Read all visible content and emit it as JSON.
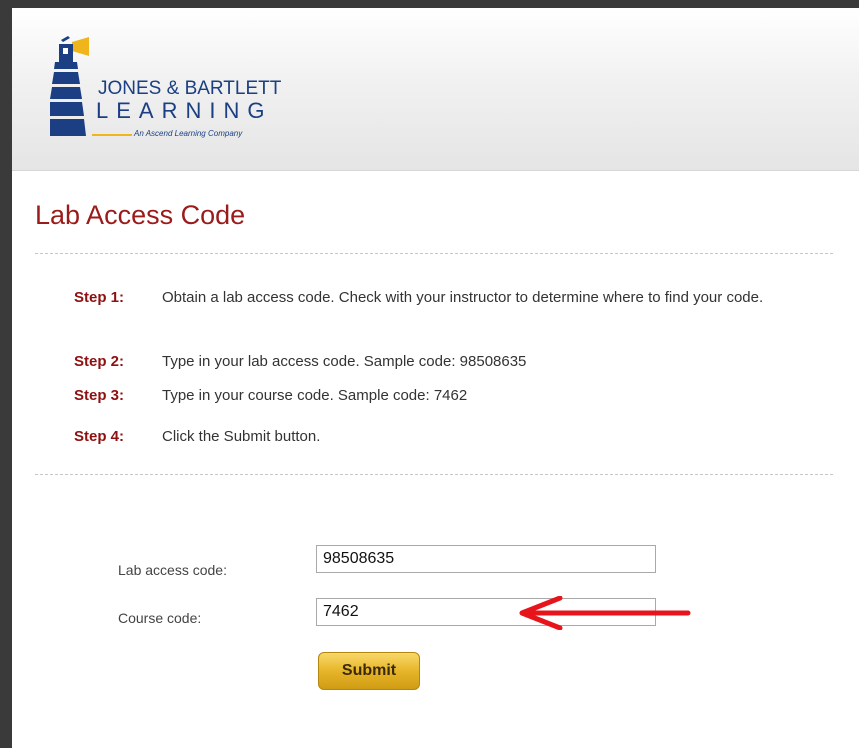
{
  "header": {
    "logo": {
      "brand_line1": "JONES & BARTLETT",
      "brand_line2": "LEARNING",
      "tagline": "An Ascend Learning Company",
      "colors": {
        "navy": "#1b3f82",
        "gold": "#f0b51a"
      }
    }
  },
  "page": {
    "title": "Lab Access Code"
  },
  "steps": [
    {
      "label": "Step 1:",
      "text": "Obtain a lab access code. Check with your instructor to determine where to find your code."
    },
    {
      "label": "Step 2:",
      "text": "Type in your lab access code. Sample code: 98508635"
    },
    {
      "label": "Step 3:",
      "text": "Type in your course code. Sample code: 7462"
    },
    {
      "label": "Step 4:",
      "text": "Click the Submit button."
    }
  ],
  "form": {
    "lab_access_label": "Lab access code:",
    "lab_access_value": "98508635",
    "course_code_label": "Course code:",
    "course_code_value": "7462",
    "submit_label": "Submit"
  },
  "annotation": {
    "arrow_color": "#e8141b",
    "icon": "left-arrow-icon"
  },
  "colors": {
    "title": "#9b1b1b",
    "step_label": "#8d1111",
    "button": "#e7b529"
  }
}
